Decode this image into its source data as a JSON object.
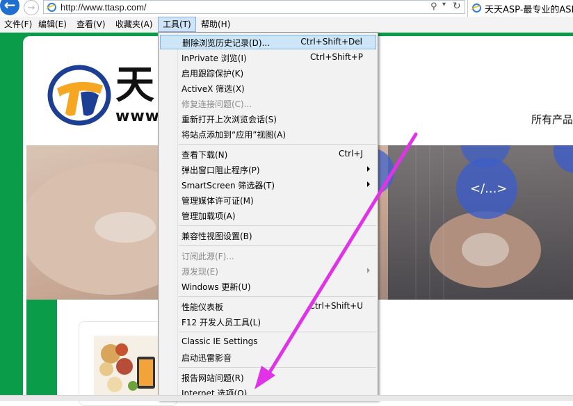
{
  "browser": {
    "url": "http://www.ttasp.com/",
    "tab_title": "天天ASP-最专业的ASP产",
    "back_icon": "back-arrow-icon",
    "forward_icon": "forward-arrow-icon"
  },
  "menubar": {
    "items": [
      "文件(F)",
      "编辑(E)",
      "查看(V)",
      "收藏夹(A)",
      "工具(T)",
      "帮助(H)"
    ],
    "active_index": 4
  },
  "tools_menu": {
    "items": [
      {
        "label": "删除浏览历史记录(D)...",
        "shortcut": "Ctrl+Shift+Del",
        "selected": true
      },
      {
        "label": "InPrivate 浏览(I)",
        "shortcut": "Ctrl+Shift+P"
      },
      {
        "label": "启用跟踪保护(K)",
        "shortcut": ""
      },
      {
        "label": "ActiveX 筛选(X)",
        "shortcut": ""
      },
      {
        "label": "修复连接问题(C)...",
        "shortcut": "",
        "disabled": true
      },
      {
        "label": "重新打开上次浏览会话(S)",
        "shortcut": ""
      },
      {
        "label": "将站点添加到“应用”视图(A)",
        "shortcut": ""
      },
      {
        "label": "查看下载(N)",
        "shortcut": "Ctrl+J"
      },
      {
        "label": "弹出窗口阻止程序(P)",
        "shortcut": "",
        "submenu": true
      },
      {
        "label": "SmartScreen 筛选器(T)",
        "shortcut": "",
        "submenu": true
      },
      {
        "label": "管理媒体许可证(M)",
        "shortcut": ""
      },
      {
        "label": "管理加载项(A)",
        "shortcut": ""
      },
      {
        "label": "兼容性视图设置(B)",
        "shortcut": ""
      },
      {
        "label": "订阅此源(F)...",
        "shortcut": "",
        "disabled": true
      },
      {
        "label": "源发现(E)",
        "shortcut": "",
        "disabled": true,
        "submenu": true
      },
      {
        "label": "Windows 更新(U)",
        "shortcut": ""
      },
      {
        "label": "性能仪表板",
        "shortcut": "Ctrl+Shift+U"
      },
      {
        "label": "F12 开发人员工具(L)",
        "shortcut": ""
      },
      {
        "label": "Classic IE Settings",
        "shortcut": ""
      },
      {
        "label": "启动迅雷影音",
        "shortcut": ""
      },
      {
        "label": "报告网站问题(R)",
        "shortcut": ""
      },
      {
        "label": "Internet 选项(O)",
        "shortcut": ""
      }
    ]
  },
  "page": {
    "logo_char": "天",
    "logo_www": "www",
    "right_text": "所有产品",
    "colors": {
      "site_green": "#0b9c4a",
      "logo_blue": "#1c3f93",
      "logo_orange": "#f5a623",
      "arrow": "#e033e8"
    }
  }
}
